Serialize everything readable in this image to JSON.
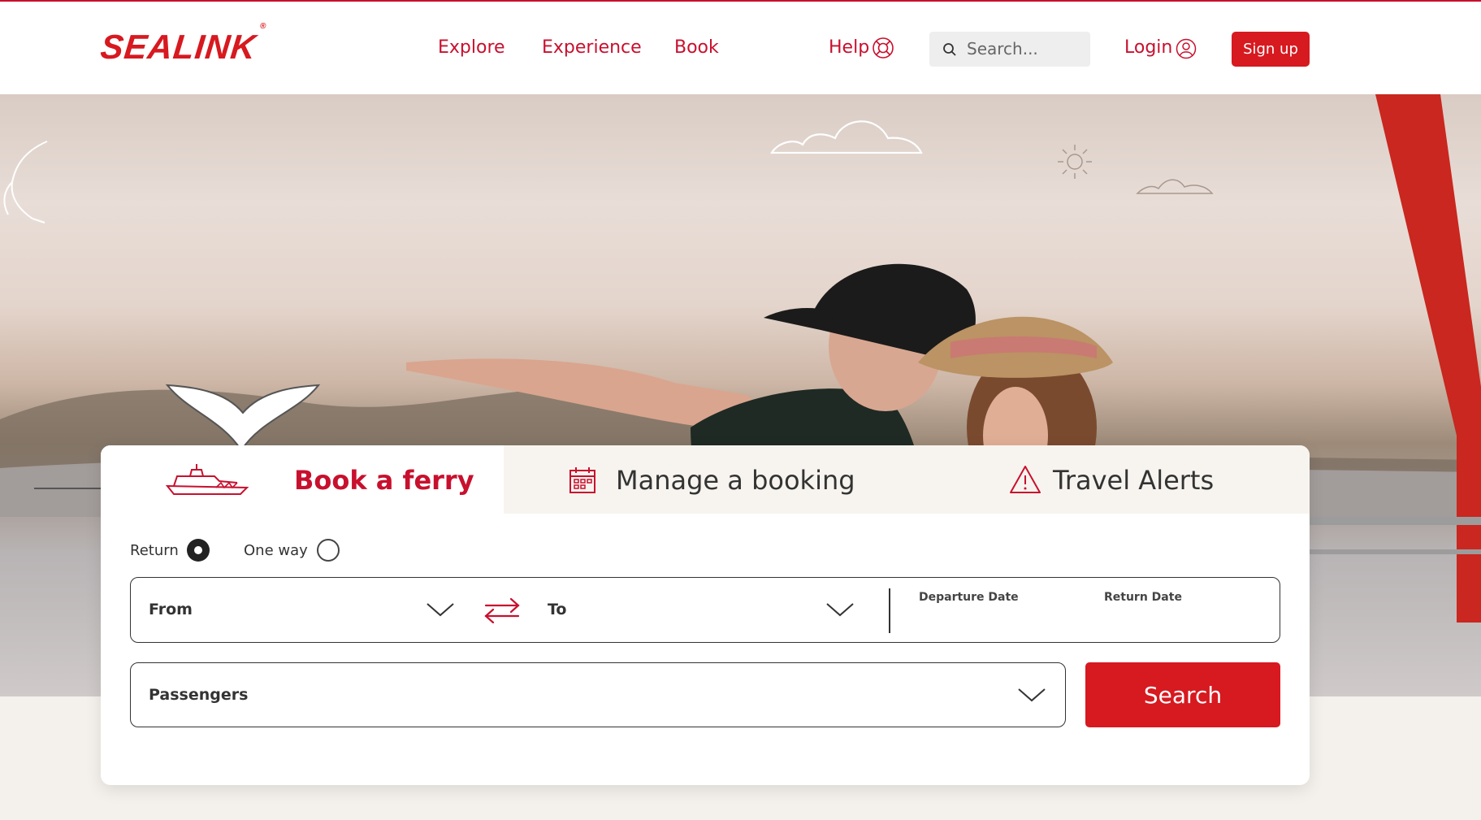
{
  "brand": {
    "name": "SEALINK",
    "mark": "®",
    "accent": "#d71920"
  },
  "nav": {
    "items": [
      {
        "label": "Explore"
      },
      {
        "label": "Experience"
      },
      {
        "label": "Book"
      }
    ],
    "help_label": "Help",
    "search_placeholder": "Search...",
    "login_label": "Login",
    "signup_label": "Sign up"
  },
  "booking": {
    "tabs": [
      {
        "label": "Book a ferry",
        "icon": "ferry-icon",
        "active": true
      },
      {
        "label": "Manage a booking",
        "icon": "calendar-icon",
        "active": false
      },
      {
        "label": "Travel Alerts",
        "icon": "warning-icon",
        "active": false
      }
    ],
    "trip_types": [
      {
        "label": "Return",
        "selected": true
      },
      {
        "label": "One way",
        "selected": false
      }
    ],
    "from_label": "From",
    "to_label": "To",
    "departure_label": "Departure Date",
    "return_label": "Return Date",
    "passengers_label": "Passengers",
    "search_label": "Search"
  }
}
